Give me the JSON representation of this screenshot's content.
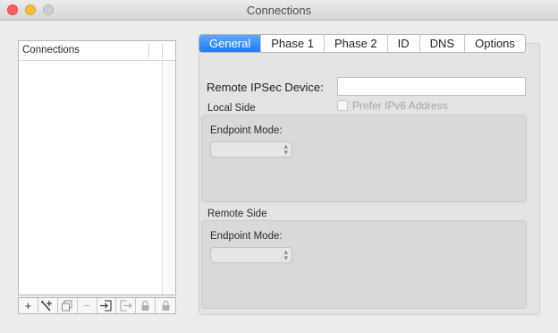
{
  "window": {
    "title": "Connections",
    "traffic_lights": [
      "close",
      "minimize",
      "zoom"
    ]
  },
  "connections": {
    "header_label": "Connections",
    "items": []
  },
  "toolbar": {
    "add_icon": "+",
    "wizard_icon": "wand-icon",
    "duplicate_icon": "duplicate-icon",
    "remove_icon": "−",
    "import_icon": "import-icon",
    "export_icon": "export-icon",
    "lock_icon": "lock-icon",
    "unlock_icon": "unlock-icon"
  },
  "tabs": [
    "General",
    "Phase 1",
    "Phase 2",
    "ID",
    "DNS",
    "Options"
  ],
  "active_tab": "General",
  "general": {
    "device_label": "Remote IPSec Device:",
    "device_value": "",
    "prefer_ipv6_label": "Prefer IPv6 Address",
    "prefer_ipv6_checked": false,
    "local_side": {
      "title": "Local Side",
      "endpoint_label": "Endpoint Mode:",
      "endpoint_value": ""
    },
    "remote_side": {
      "title": "Remote Side",
      "endpoint_label": "Endpoint Mode:",
      "endpoint_value": ""
    }
  },
  "colors": {
    "active_tab": "#1a7cf6",
    "close": "#fc605c",
    "minimize": "#fdbc40",
    "zoom_disabled": "#cfcfcf"
  }
}
